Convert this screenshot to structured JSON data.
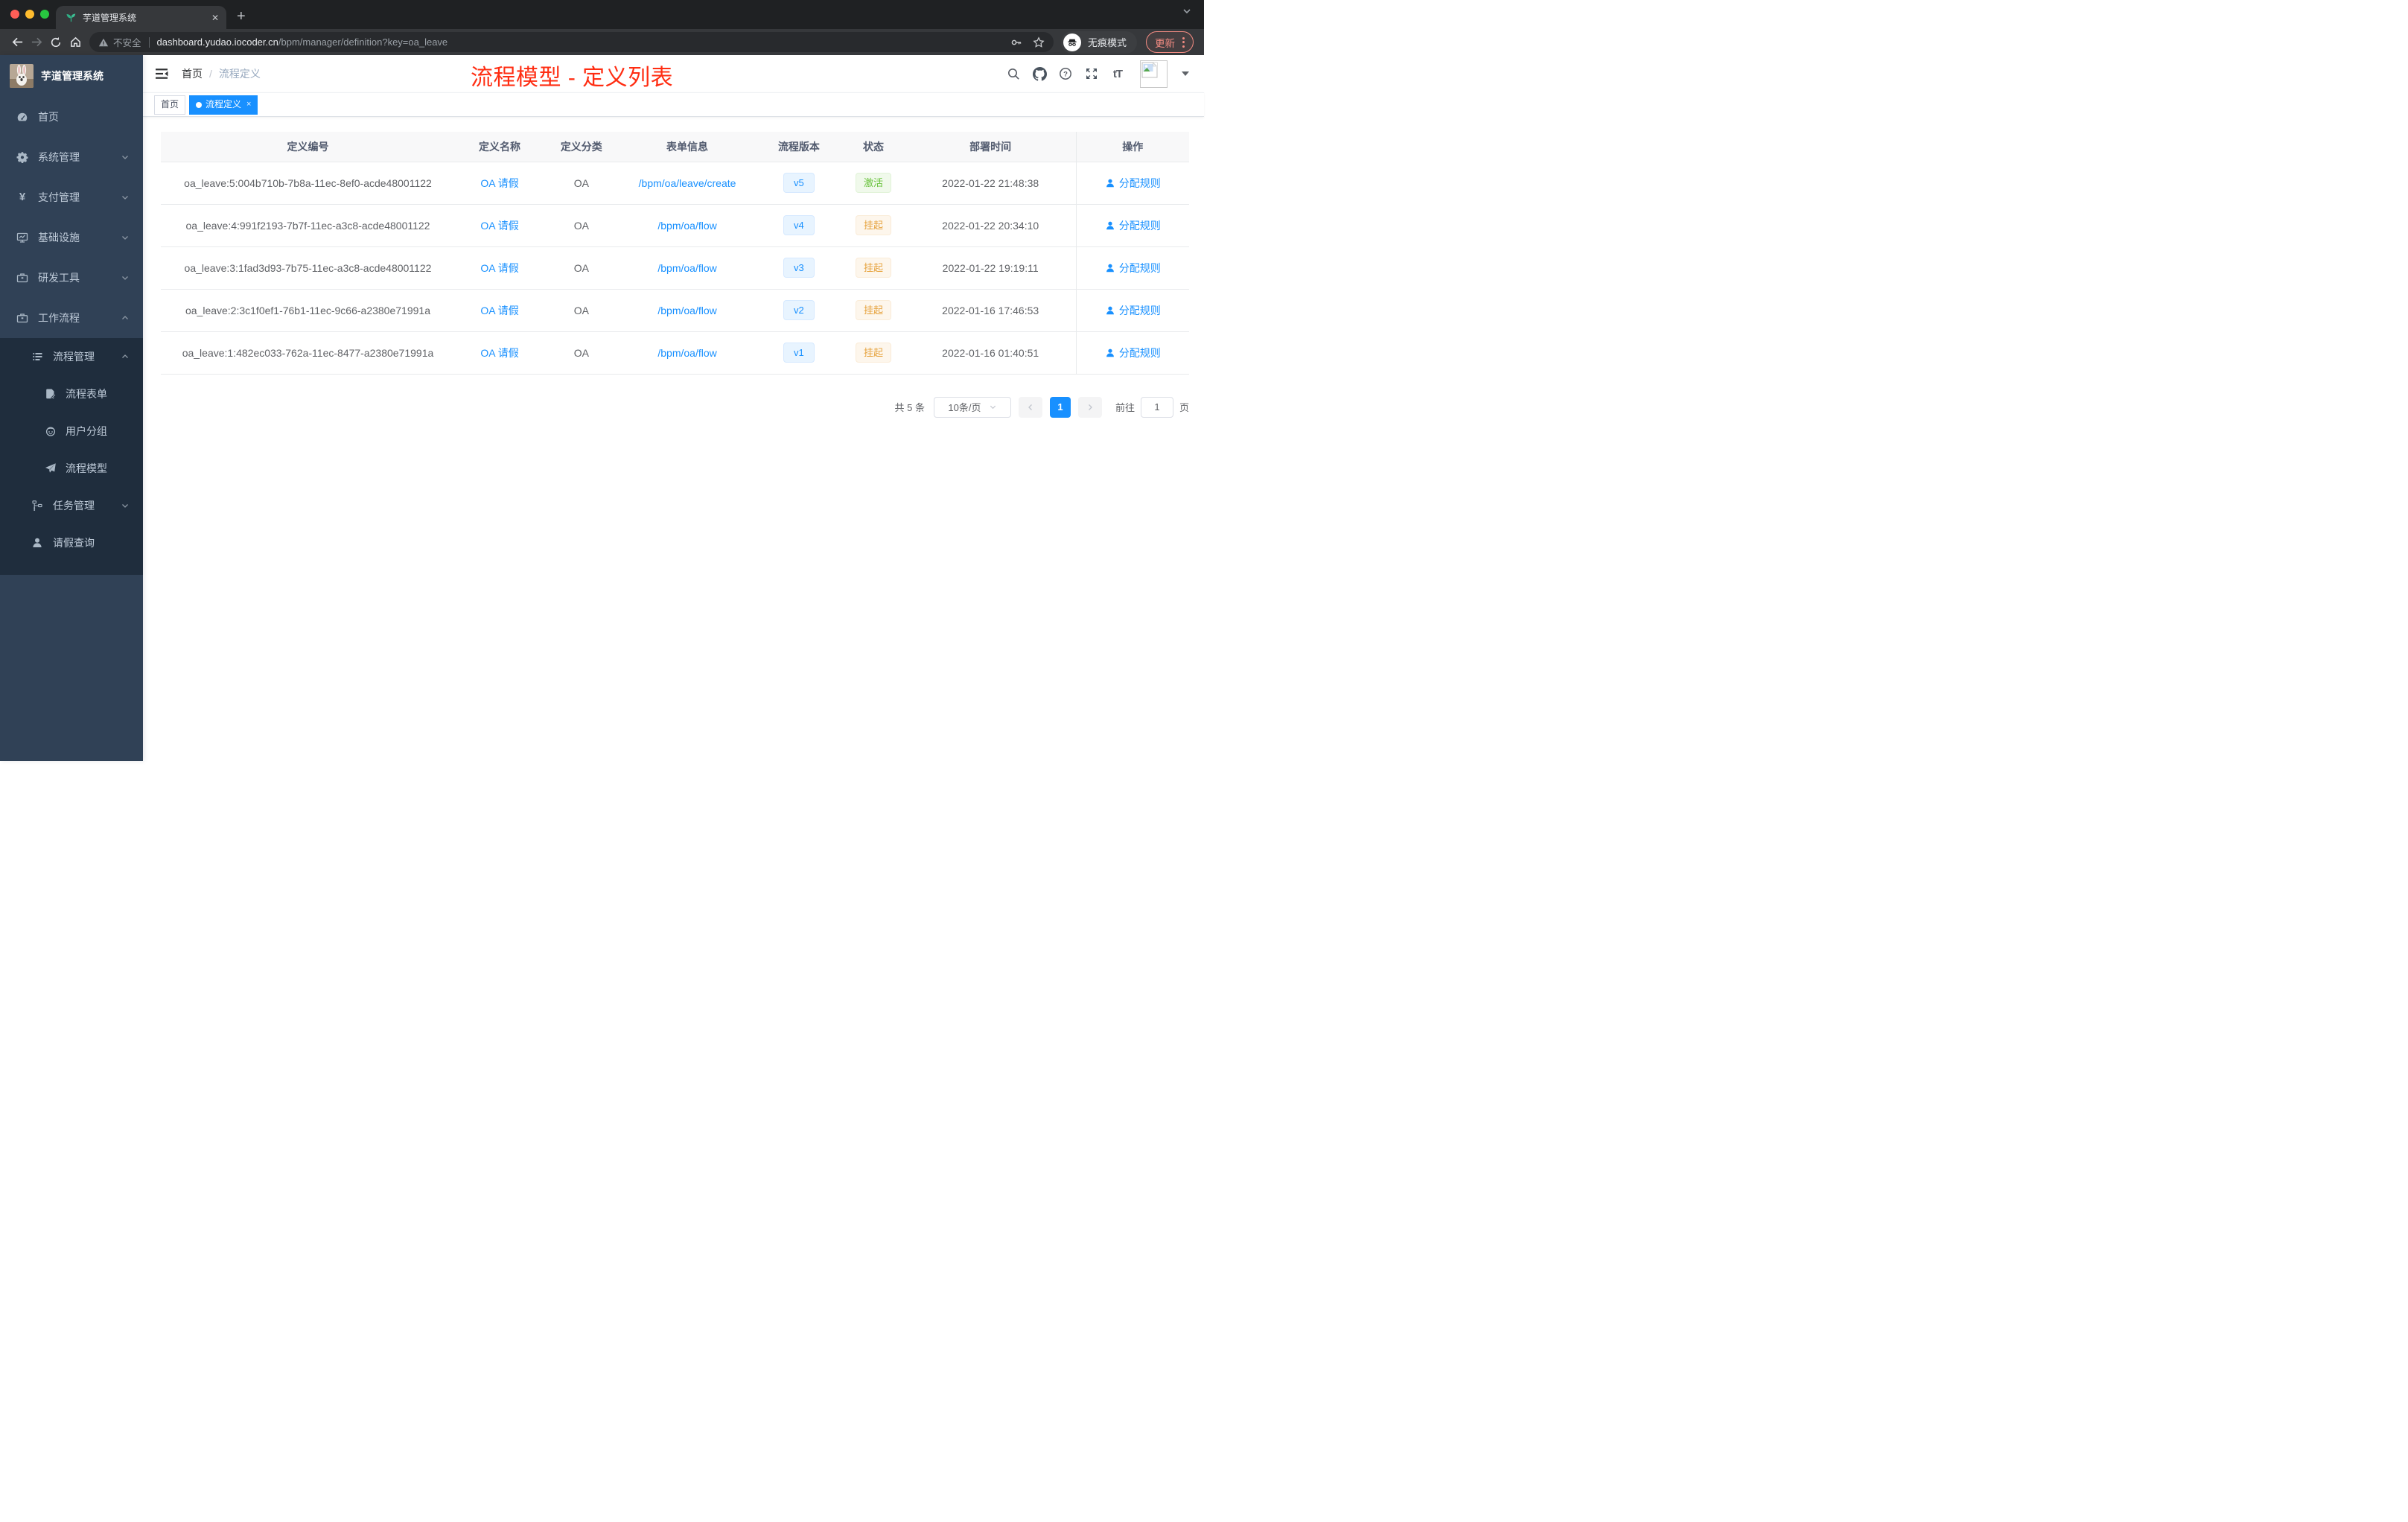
{
  "browser": {
    "tab_title": "芋道管理系统",
    "new_tab_label": "+",
    "security_label": "不安全",
    "url_host": "dashboard.yudao.iocoder.cn",
    "url_path": "/bpm/manager/definition?key=oa_leave",
    "incognito_label": "无痕模式",
    "update_label": "更新"
  },
  "sidebar": {
    "app_title": "芋道管理系统",
    "items": [
      {
        "label": "首页"
      },
      {
        "label": "系统管理"
      },
      {
        "label": "支付管理"
      },
      {
        "label": "基础设施"
      },
      {
        "label": "研发工具"
      },
      {
        "label": "工作流程"
      }
    ],
    "submenu": {
      "process_mgmt": {
        "label": "流程管理"
      },
      "children": [
        {
          "label": "流程表单"
        },
        {
          "label": "用户分组"
        },
        {
          "label": "流程模型"
        }
      ],
      "task_mgmt": {
        "label": "任务管理"
      },
      "leave_query": {
        "label": "请假查询"
      }
    }
  },
  "header": {
    "breadcrumb": {
      "home": "首页",
      "separator": "/",
      "current": "流程定义"
    }
  },
  "annotation": {
    "title": "流程模型 - 定义列表"
  },
  "tags": {
    "home": "首页",
    "active": "流程定义",
    "close": "×"
  },
  "table": {
    "columns": [
      "定义编号",
      "定义名称",
      "定义分类",
      "表单信息",
      "流程版本",
      "状态",
      "部署时间",
      "操作"
    ],
    "rows": [
      {
        "id": "oa_leave:5:004b710b-7b8a-11ec-8ef0-acde48001122",
        "name": "OA 请假",
        "category": "OA",
        "form": "/bpm/oa/leave/create",
        "version": "v5",
        "status": "激活",
        "status_type": "active",
        "time": "2022-01-22 21:48:38",
        "action": "分配规则"
      },
      {
        "id": "oa_leave:4:991f2193-7b7f-11ec-a3c8-acde48001122",
        "name": "OA 请假",
        "category": "OA",
        "form": "/bpm/oa/flow",
        "version": "v4",
        "status": "挂起",
        "status_type": "suspended",
        "time": "2022-01-22 20:34:10",
        "action": "分配规则"
      },
      {
        "id": "oa_leave:3:1fad3d93-7b75-11ec-a3c8-acde48001122",
        "name": "OA 请假",
        "category": "OA",
        "form": "/bpm/oa/flow",
        "version": "v3",
        "status": "挂起",
        "status_type": "suspended",
        "time": "2022-01-22 19:19:11",
        "action": "分配规则"
      },
      {
        "id": "oa_leave:2:3c1f0ef1-76b1-11ec-9c66-a2380e71991a",
        "name": "OA 请假",
        "category": "OA",
        "form": "/bpm/oa/flow",
        "version": "v2",
        "status": "挂起",
        "status_type": "suspended",
        "time": "2022-01-16 17:46:53",
        "action": "分配规则"
      },
      {
        "id": "oa_leave:1:482ec033-762a-11ec-8477-a2380e71991a",
        "name": "OA 请假",
        "category": "OA",
        "form": "/bpm/oa/flow",
        "version": "v1",
        "status": "挂起",
        "status_type": "suspended",
        "time": "2022-01-16 01:40:51",
        "action": "分配规则"
      }
    ]
  },
  "pagination": {
    "total": "共 5 条",
    "page_size": "10条/页",
    "current_page": "1",
    "goto_label": "前往",
    "goto_value": "1",
    "page_unit": "页"
  },
  "colors": {
    "accent_blue": "#1890ff",
    "status_green": "#67c23a",
    "status_orange": "#e6a23c",
    "annotation_red": "#ff2d12",
    "sidebar_bg": "#304156",
    "submenu_bg": "#1f2d3d"
  }
}
